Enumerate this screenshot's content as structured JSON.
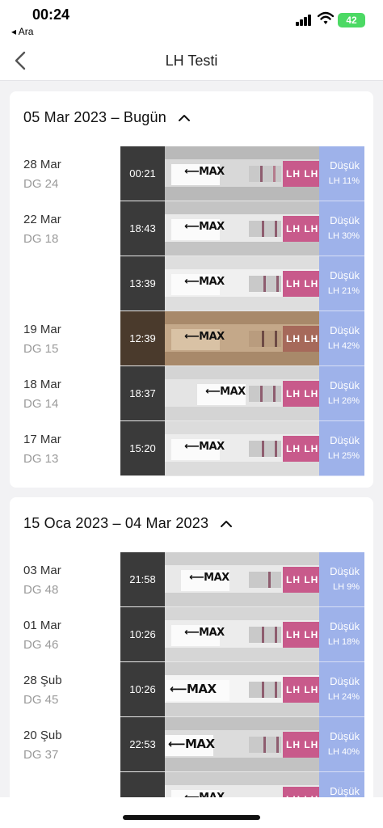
{
  "status_bar": {
    "time": "00:24",
    "back_app": "◂ Ara",
    "battery": "42"
  },
  "nav": {
    "title": "LH Testi"
  },
  "sections": [
    {
      "header": "05 Mar 2023 – Bugün",
      "rows": [
        {
          "date": "28 Mar",
          "cycle": "DG 24",
          "time": "00:21",
          "result": "Düşük",
          "lh": "LH 11%"
        },
        {
          "date": "22 Mar",
          "cycle": "DG 18",
          "time": "18:43",
          "result": "Düşük",
          "lh": "LH 30%"
        },
        {
          "date": "",
          "cycle": "",
          "time": "13:39",
          "result": "Düşük",
          "lh": "LH 21%"
        },
        {
          "date": "19 Mar",
          "cycle": "DG 15",
          "time": "12:39",
          "result": "Düşük",
          "lh": "LH 42%"
        },
        {
          "date": "18 Mar",
          "cycle": "DG 14",
          "time": "18:37",
          "result": "Düşük",
          "lh": "LH 26%"
        },
        {
          "date": "17 Mar",
          "cycle": "DG 13",
          "time": "15:20",
          "result": "Düşük",
          "lh": "LH 25%"
        }
      ]
    },
    {
      "header": "15 Oca 2023 – 04 Mar 2023",
      "rows": [
        {
          "date": "03 Mar",
          "cycle": "DG 48",
          "time": "21:58",
          "result": "Düşük",
          "lh": "LH 9%"
        },
        {
          "date": "01 Mar",
          "cycle": "DG 46",
          "time": "10:26",
          "result": "Düşük",
          "lh": "LH 18%"
        },
        {
          "date": "28 Şub",
          "cycle": "DG 45",
          "time": "10:26",
          "result": "Düşük",
          "lh": "LH 24%"
        },
        {
          "date": "20 Şub",
          "cycle": "DG 37",
          "time": "22:53",
          "result": "Düşük",
          "lh": "LH 40%"
        },
        {
          "date": "",
          "cycle": "",
          "time": "",
          "result": "Düşük",
          "lh": ""
        }
      ]
    }
  ],
  "strip_text": {
    "max": "⟵MAX",
    "lh": "LH LH"
  },
  "colors": {
    "accent": "#9eb2ea",
    "strip_pink": "#c85a8b",
    "time_cell": "#3a3a3a"
  },
  "icons": {
    "back": "chevron-left-icon",
    "collapse": "chevron-up-icon"
  }
}
